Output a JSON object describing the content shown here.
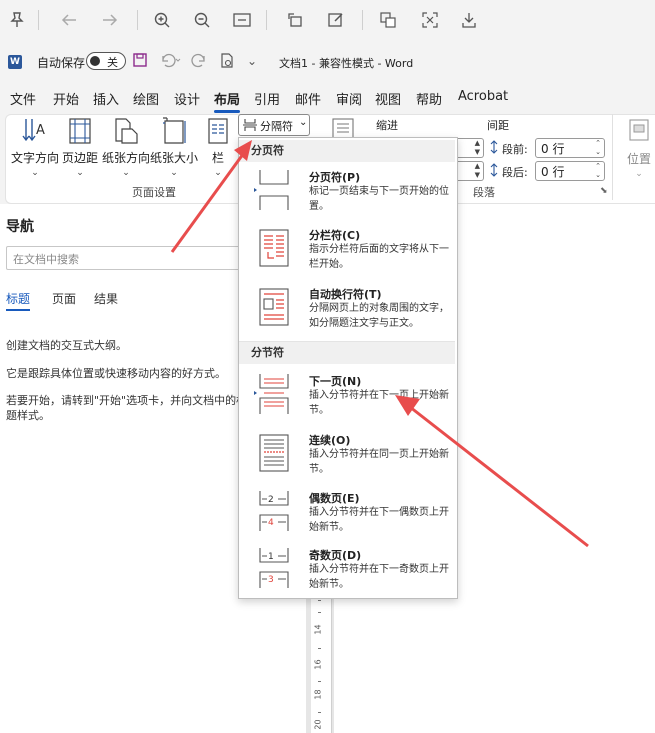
{
  "title_bar": {
    "autosave_label": "自动保存",
    "autosave_state": "关",
    "doc_title": "文档1 - 兼容性模式 - Word",
    "app_badge": "W"
  },
  "tabs": [
    "文件",
    "开始",
    "插入",
    "绘图",
    "设计",
    "布局",
    "引用",
    "邮件",
    "审阅",
    "视图",
    "帮助",
    "Acrobat"
  ],
  "active_tab": "布局",
  "ribbon": {
    "text_direction": "文字方向",
    "margins": "页边距",
    "orientation": "纸张方向",
    "size": "纸张大小",
    "columns": "栏",
    "breaks": "分隔符",
    "group_page_setup": "页面设置",
    "indent_label": "缩进",
    "spacing_label": "间距",
    "before_label": "段前:",
    "after_label": "段后:",
    "before_value": "0 行",
    "after_value": "0 行",
    "group_paragraph": "段落",
    "position": "位置"
  },
  "nav": {
    "title": "导航",
    "search_placeholder": "在文档中搜索",
    "tab_headings": "标题",
    "tab_pages": "页面",
    "tab_results": "结果",
    "line1": "创建文档的交互式大纲。",
    "line2": "它是跟踪具体位置或快速移动内容的好方式。",
    "line3a": "若要开始，请转到\"开始\"选项卡，并向文档中的标",
    "line3b": "题样式。"
  },
  "dropdown": {
    "section_page": "分页符",
    "section_section": "分节符",
    "items": [
      {
        "title": "分页符(P)",
        "desc": "标记一页结束与下一页开始的位置。"
      },
      {
        "title": "分栏符(C)",
        "desc": "指示分栏符后面的文字将从下一栏开始。"
      },
      {
        "title": "自动换行符(T)",
        "desc": "分隔网页上的对象周围的文字，如分隔题注文字与正文。"
      },
      {
        "title": "下一页(N)",
        "desc": "插入分节符并在下一页上开始新节。"
      },
      {
        "title": "连续(O)",
        "desc": "插入分节符并在同一页上开始新节。"
      },
      {
        "title": "偶数页(E)",
        "desc": "插入分节符并在下一偶数页上开始新节。"
      },
      {
        "title": "奇数页(D)",
        "desc": "插入分节符并在下一奇数页上开始新节。"
      }
    ]
  },
  "ruler": [
    "14",
    "16",
    "18",
    "20"
  ],
  "colors": {
    "accent": "#185abd",
    "arrow": "#e84d4d"
  }
}
